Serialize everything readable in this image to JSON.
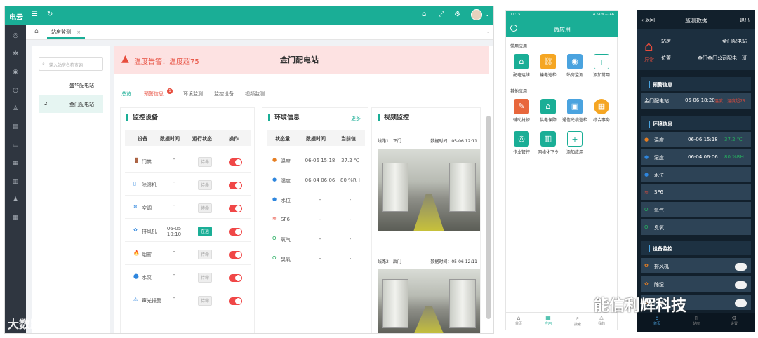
{
  "desktop": {
    "brand": "电云",
    "tab": {
      "label": "站房监测",
      "close": "×"
    },
    "search_placeholder": "输入站房名称查询",
    "stations": [
      {
        "no": "1",
        "name": "盛华配电站"
      },
      {
        "no": "2",
        "name": "金门配电站"
      }
    ],
    "alarm": {
      "text": "温度告警：温度超75",
      "station": "金门配电站"
    },
    "subtabs": [
      "总览",
      "预警信息",
      "环境监测",
      "监控设备",
      "视频监测"
    ],
    "subtab_badge": "1",
    "equipment": {
      "title": "监控设备",
      "headers": [
        "设备",
        "数据时间",
        "运行状态",
        "操作"
      ],
      "rows": [
        {
          "icon": "🚪",
          "name": "门禁",
          "time": "-",
          "status": "待命"
        },
        {
          "icon": "▯",
          "name": "除湿机",
          "time": "-",
          "status": "待命"
        },
        {
          "icon": "❄",
          "name": "空调",
          "time": "-",
          "status": "待命"
        },
        {
          "icon": "✿",
          "name": "排风机",
          "time": "06-05 10:10",
          "status": "在运"
        },
        {
          "icon": "🔥",
          "name": "烟雾",
          "time": "-",
          "status": "待命"
        },
        {
          "icon": "⬤",
          "name": "水泵",
          "time": "-",
          "status": "待命"
        },
        {
          "icon": "⚠",
          "name": "声光报警",
          "time": "-",
          "status": "待命"
        }
      ]
    },
    "env": {
      "title": "环境信息",
      "more": "更多",
      "headers": [
        "状态量",
        "数据时间",
        "当前值"
      ],
      "rows": [
        {
          "name": "温度",
          "time": "06-06 15:18",
          "value": "37.2 ℃"
        },
        {
          "name": "湿度",
          "time": "06-04 06:06",
          "value": "80 %RH"
        },
        {
          "name": "水位",
          "time": "-",
          "value": "-"
        },
        {
          "name": "SF6",
          "time": "-",
          "value": "-"
        },
        {
          "name": "氧气",
          "time": "-",
          "value": "-"
        },
        {
          "name": "臭氧",
          "time": "-",
          "value": "-"
        }
      ]
    },
    "video": {
      "title": "视频监控",
      "lines": [
        {
          "name": "线路1：正门",
          "time": "数据时间：05-06 12:11"
        },
        {
          "name": "线路2：后门",
          "time": "数据时间：05-06 12:11"
        }
      ]
    }
  },
  "phone1": {
    "status_time": "11:15",
    "status_right": "4.5K/s ⋯ 46",
    "title": "微应用",
    "section1": "常用应用",
    "apps1": [
      "配电运维",
      "输电巡检",
      "站房监测",
      "添加常用"
    ],
    "section2": "其他应用",
    "apps2": [
      "辅助抢修",
      "供电保障",
      "通信光缆巡检",
      "综合事务",
      "作业管控",
      "网格化下令",
      "添加应用"
    ],
    "nav": [
      "首页",
      "应用",
      "搜索",
      "我的"
    ]
  },
  "phone2": {
    "back": "返回",
    "title": "监测数据",
    "exit": "退出",
    "station_label": "站房",
    "station_value": "金门配电站",
    "pos_label": "位置",
    "pos_value": "金门金门公司配电一班",
    "abnormal": "异常",
    "warn_section": "预警信息",
    "warn": {
      "station": "金门配电站",
      "time": "05-06 18:20",
      "msg": "温度：温度超75"
    },
    "env_section": "环境信息",
    "env": [
      {
        "name": "温度",
        "time": "06-06 15:18",
        "value": "37.2 ℃"
      },
      {
        "name": "湿度",
        "time": "06-04 06:06",
        "value": "80 %RH"
      },
      {
        "name": "水位"
      },
      {
        "name": "SF6"
      },
      {
        "name": "氧气"
      },
      {
        "name": "臭氧"
      }
    ],
    "dev_section": "设备监控",
    "devices": [
      "排风机",
      "除湿",
      "门禁"
    ],
    "nav": [
      "首页",
      "站房",
      "设置"
    ]
  },
  "watermark_right": "能信利辉科技",
  "watermark_left": "大数跨境"
}
